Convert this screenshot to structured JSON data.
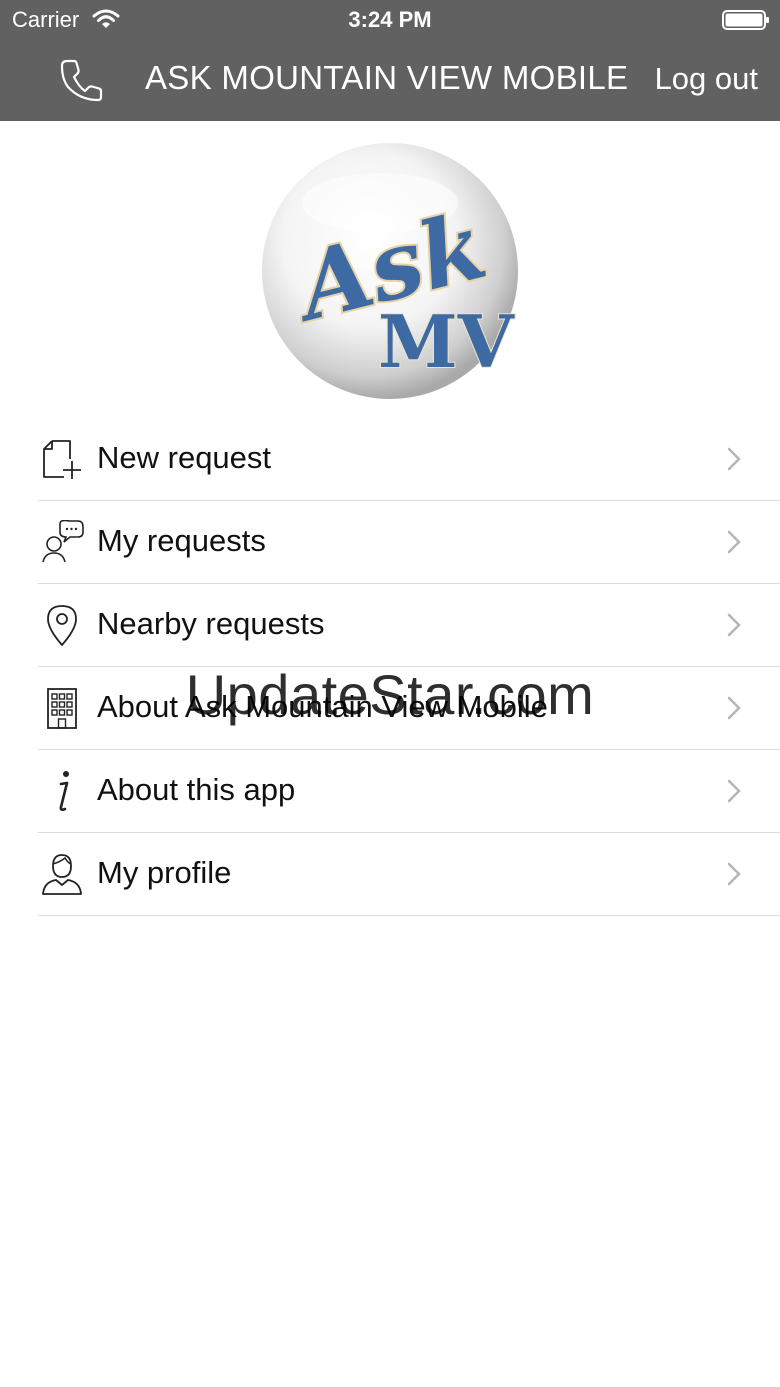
{
  "status_bar": {
    "carrier": "Carrier",
    "time": "3:24 PM"
  },
  "header": {
    "title": "ASK MOUNTAIN VIEW MOBILE",
    "logout_label": "Log out",
    "call_icon": "phone-icon"
  },
  "logo": {
    "text_top": "Ask",
    "text_bottom": "MV"
  },
  "menu": {
    "items": [
      {
        "label": "New request",
        "icon": "new-document-icon"
      },
      {
        "label": "My requests",
        "icon": "person-speech-icon"
      },
      {
        "label": "Nearby requests",
        "icon": "map-pin-icon"
      },
      {
        "label": "About Ask Mountain View Mobile",
        "icon": "building-icon"
      },
      {
        "label": "About this app",
        "icon": "info-icon"
      },
      {
        "label": "My profile",
        "icon": "user-profile-icon"
      }
    ]
  },
  "watermark": "UpdateStar.com",
  "colors": {
    "header_bg": "#616161",
    "divider": "#dcdcdc",
    "chevron": "#b5b5b5",
    "logo_blue": "#3d6aa3"
  }
}
